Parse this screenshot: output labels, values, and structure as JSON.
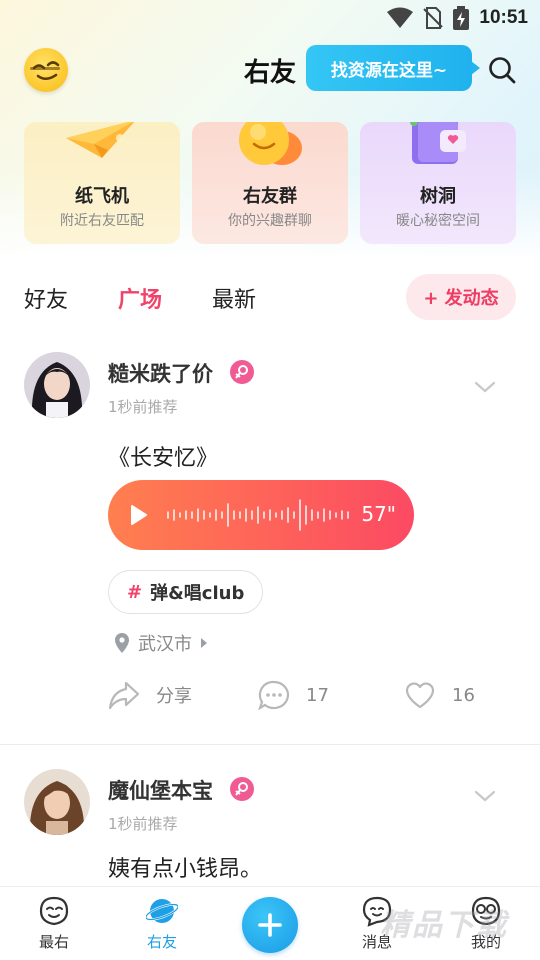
{
  "status_bar": {
    "time": "10:51",
    "icons": [
      "wifi-icon",
      "no-sim-icon",
      "battery-charging-icon"
    ]
  },
  "header": {
    "title": "右友",
    "tooltip": "找资源在这里~",
    "icons": [
      "avatar-emoji-icon",
      "search-icon"
    ]
  },
  "feature_cards": [
    {
      "title": "纸飞机",
      "subtitle": "附近右友匹配",
      "icon": "paper-plane-icon",
      "color": "#fbefc3"
    },
    {
      "title": "右友群",
      "subtitle": "你的兴趣群聊",
      "icon": "group-chat-icon",
      "color": "#fbd9cf"
    },
    {
      "title": "树洞",
      "subtitle": "暖心秘密空间",
      "icon": "tree-hole-icon",
      "color": "#ead8fb"
    }
  ],
  "feed_tabs": {
    "items": [
      "好友",
      "广场",
      "最新"
    ],
    "active": "广场",
    "post_button": "+ 发动态"
  },
  "posts": [
    {
      "author": "糙米跌了价",
      "time": "1秒前推荐",
      "text": "《长安忆》",
      "voice_duration": "57\"",
      "topic": "弹&唱club",
      "topic_hash": "#",
      "location": "武汉市",
      "share_label": "分享",
      "comment_count": "17",
      "like_count": "16"
    },
    {
      "author": "魔仙堡本宝",
      "time": "1秒前推荐",
      "text": "姨有点小钱昂。"
    }
  ],
  "bottom_nav": {
    "items": [
      {
        "label": "最右",
        "icon": "zuiyou-face-icon"
      },
      {
        "label": "右友",
        "icon": "planet-icon",
        "active": true
      },
      {
        "label": "",
        "icon": "plus-icon"
      },
      {
        "label": "消息",
        "icon": "message-face-icon"
      },
      {
        "label": "我的",
        "icon": "profile-face-icon"
      }
    ]
  },
  "watermark": "精品下载",
  "colors": {
    "accent_pink": "#f0426a",
    "accent_blue": "#1e9fe6",
    "voice_gradient_start": "#ff7f4f",
    "voice_gradient_end": "#fc4a63"
  }
}
